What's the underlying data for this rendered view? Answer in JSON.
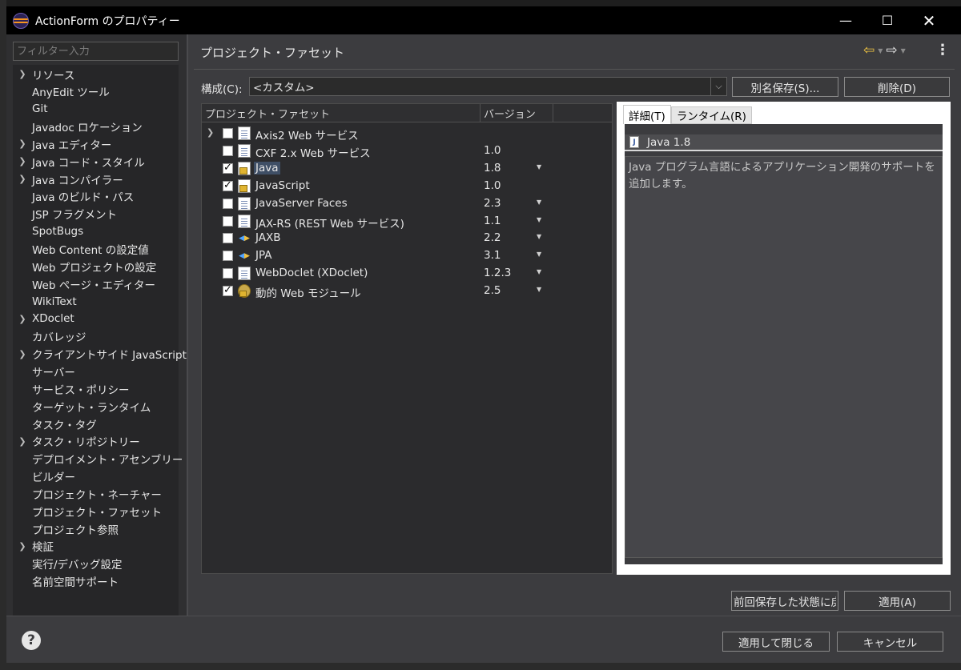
{
  "window": {
    "title": "ActionForm のプロパティー",
    "minimize": "—",
    "maximize": "☐",
    "close": "✕"
  },
  "filter": {
    "placeholder": "フィルター入力"
  },
  "sidebar": {
    "items": [
      {
        "label": "リソース",
        "expandable": true
      },
      {
        "label": "AnyEdit ツール",
        "expandable": false
      },
      {
        "label": "Git",
        "expandable": false
      },
      {
        "label": "Javadoc ロケーション",
        "expandable": false
      },
      {
        "label": "Java エディター",
        "expandable": true
      },
      {
        "label": "Java コード・スタイル",
        "expandable": true
      },
      {
        "label": "Java コンパイラー",
        "expandable": true
      },
      {
        "label": "Java のビルド・パス",
        "expandable": false
      },
      {
        "label": "JSP フラグメント",
        "expandable": false
      },
      {
        "label": "SpotBugs",
        "expandable": false
      },
      {
        "label": "Web Content の設定値",
        "expandable": false
      },
      {
        "label": "Web プロジェクトの設定",
        "expandable": false
      },
      {
        "label": "Web ページ・エディター",
        "expandable": false
      },
      {
        "label": "WikiText",
        "expandable": false
      },
      {
        "label": "XDoclet",
        "expandable": true
      },
      {
        "label": "カバレッジ",
        "expandable": false
      },
      {
        "label": "クライアントサイド JavaScript",
        "expandable": true
      },
      {
        "label": "サーバー",
        "expandable": false
      },
      {
        "label": "サービス・ポリシー",
        "expandable": false
      },
      {
        "label": "ターゲット・ランタイム",
        "expandable": false
      },
      {
        "label": "タスク・タグ",
        "expandable": false
      },
      {
        "label": "タスク・リポジトリー",
        "expandable": true
      },
      {
        "label": "デプロイメント・アセンブリー",
        "expandable": false
      },
      {
        "label": "ビルダー",
        "expandable": false
      },
      {
        "label": "プロジェクト・ネーチャー",
        "expandable": false
      },
      {
        "label": "プロジェクト・ファセット",
        "expandable": false
      },
      {
        "label": "プロジェクト参照",
        "expandable": false
      },
      {
        "label": "検証",
        "expandable": true
      },
      {
        "label": "実行/デバッグ設定",
        "expandable": false
      },
      {
        "label": "名前空間サポート",
        "expandable": false
      }
    ]
  },
  "page": {
    "title": "プロジェクト・ファセット",
    "config_label": "構成(C):",
    "config_value": "<カスタム>",
    "save_as": "別名保存(S)...",
    "delete": "削除(D)"
  },
  "table": {
    "col_facet": "プロジェクト・ファセット",
    "col_version": "バージョン",
    "rows": [
      {
        "name": "Axis2 Web サービス",
        "version": "",
        "checked": false,
        "expandable": true,
        "icon": "document-icon",
        "dropdown": false
      },
      {
        "name": "CXF 2.x Web サービス",
        "version": "1.0",
        "checked": false,
        "expandable": false,
        "icon": "document-icon",
        "dropdown": false
      },
      {
        "name": "Java",
        "version": "1.8",
        "checked": true,
        "expandable": false,
        "icon": "locked-document-icon",
        "dropdown": true,
        "selected": true
      },
      {
        "name": "JavaScript",
        "version": "1.0",
        "checked": true,
        "expandable": false,
        "icon": "locked-document-icon",
        "dropdown": false
      },
      {
        "name": "JavaServer Faces",
        "version": "2.3",
        "checked": false,
        "expandable": false,
        "icon": "document-icon",
        "dropdown": true
      },
      {
        "name": "JAX-RS (REST Web サービス)",
        "version": "1.1",
        "checked": false,
        "expandable": false,
        "icon": "document-icon",
        "dropdown": true
      },
      {
        "name": "JAXB",
        "version": "2.2",
        "checked": false,
        "expandable": false,
        "icon": "xml-icon",
        "dropdown": true
      },
      {
        "name": "JPA",
        "version": "3.1",
        "checked": false,
        "expandable": false,
        "icon": "xml-icon",
        "dropdown": true
      },
      {
        "name": "WebDoclet (XDoclet)",
        "version": "1.2.3",
        "checked": false,
        "expandable": false,
        "icon": "document-icon",
        "dropdown": true
      },
      {
        "name": "動的 Web モジュール",
        "version": "2.5",
        "checked": true,
        "expandable": false,
        "icon": "web-module-icon",
        "dropdown": true
      }
    ]
  },
  "details": {
    "tab_details": "詳細(T)",
    "tab_runtime": "ランタイム(R)",
    "icon_letter": "J",
    "title": "Java 1.8",
    "description": "Java プログラム言語によるアプリケーション開発のサポートを追加します。"
  },
  "footer": {
    "restore": "前回保存した状態に戻す",
    "apply": "適用(A)",
    "apply_close": "適用して閉じる",
    "cancel": "キャンセル",
    "help": "?"
  }
}
